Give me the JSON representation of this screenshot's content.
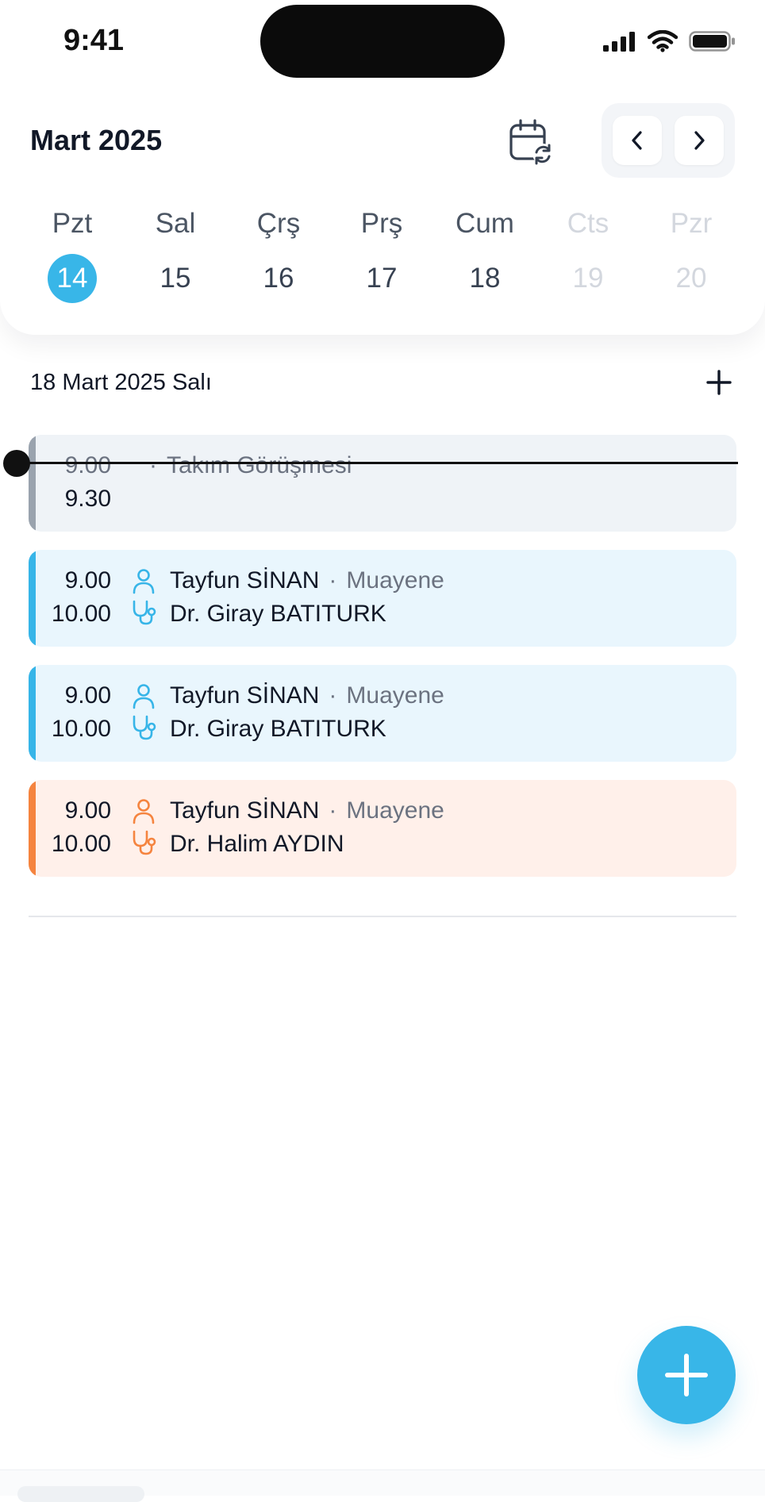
{
  "status": {
    "time": "9:41"
  },
  "header": {
    "month_title": "Mart 2025"
  },
  "week": [
    {
      "label": "Pzt",
      "num": "14",
      "state": "selected"
    },
    {
      "label": "Sal",
      "num": "15",
      "state": "normal"
    },
    {
      "label": "Çrş",
      "num": "16",
      "state": "normal"
    },
    {
      "label": "Prş",
      "num": "17",
      "state": "normal"
    },
    {
      "label": "Cum",
      "num": "18",
      "state": "normal"
    },
    {
      "label": "Cts",
      "num": "19",
      "state": "muted"
    },
    {
      "label": "Pzr",
      "num": "20",
      "state": "muted"
    }
  ],
  "day": {
    "heading": "18 Mart 2025 Salı"
  },
  "events": [
    {
      "start": "9.00",
      "end": "9.30",
      "title": "Takım Görüşmesi",
      "kind": "gray"
    },
    {
      "start": "9.00",
      "end": "10.00",
      "patient": "Tayfun SİNAN",
      "type": "Muayene",
      "doctor": "Dr. Giray BATITURK",
      "kind": "blue"
    },
    {
      "start": "9.00",
      "end": "10.00",
      "patient": "Tayfun SİNAN",
      "type": "Muayene",
      "doctor": "Dr. Giray BATITURK",
      "kind": "blue"
    },
    {
      "start": "9.00",
      "end": "10.00",
      "patient": "Tayfun SİNAN",
      "type": "Muayene",
      "doctor": "Dr. Halim AYDIN",
      "kind": "orange"
    }
  ],
  "icons": {
    "calendar": "calendar-refresh-icon",
    "prev": "chevron-left-icon",
    "next": "chevron-right-icon",
    "add": "plus-icon",
    "patient": "person-icon",
    "doctor": "stethoscope-icon"
  },
  "colors": {
    "accent": "#38b6e8",
    "orange": "#f5843f",
    "gray_bar": "#9aa3ae"
  }
}
